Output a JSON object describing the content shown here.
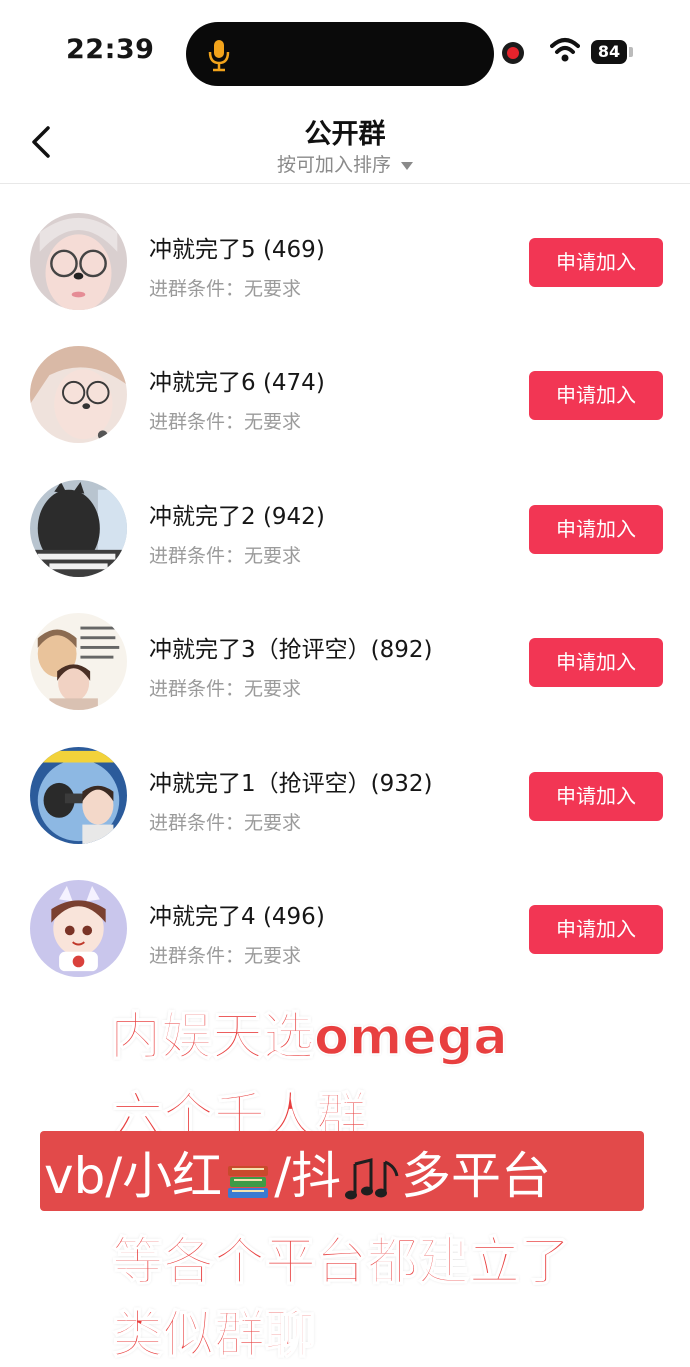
{
  "status_bar": {
    "time": "22:39",
    "battery": "84"
  },
  "header": {
    "title": "公开群",
    "sort_label": "按可加入排序"
  },
  "groups": [
    {
      "name": "冲就完了5 (469)",
      "condition": "进群条件：无要求",
      "button": "申请加入"
    },
    {
      "name": "冲就完了6 (474)",
      "condition": "进群条件：无要求",
      "button": "申请加入"
    },
    {
      "name": "冲就完了2 (942)",
      "condition": "进群条件：无要求",
      "button": "申请加入"
    },
    {
      "name": "冲就完了3（抢评空）(892)",
      "condition": "进群条件：无要求",
      "button": "申请加入"
    },
    {
      "name": "冲就完了1（抢评空）(932)",
      "condition": "进群条件：无要求",
      "button": "申请加入"
    },
    {
      "name": "冲就完了4 (496)",
      "condition": "进群条件：无要求",
      "button": "申请加入"
    }
  ],
  "overlay": {
    "line1": "内娱天选omega",
    "line2": "六个千人群",
    "line3_a": "vb/小红",
    "line3_b": "/抖",
    "line3_c": "多平台",
    "line4": "等各个平台都建立了",
    "line5": "类似群聊"
  },
  "colors": {
    "accent": "#f23654",
    "overlay_red": "#e83f3f",
    "band_red": "#e24a4a"
  },
  "icons": [
    "back-arrow-icon",
    "microphone-icon",
    "recording-dot-icon",
    "wifi-icon",
    "battery-icon",
    "dropdown-caret-icon",
    "books-emoji-icon",
    "music-notes-emoji-icon"
  ]
}
